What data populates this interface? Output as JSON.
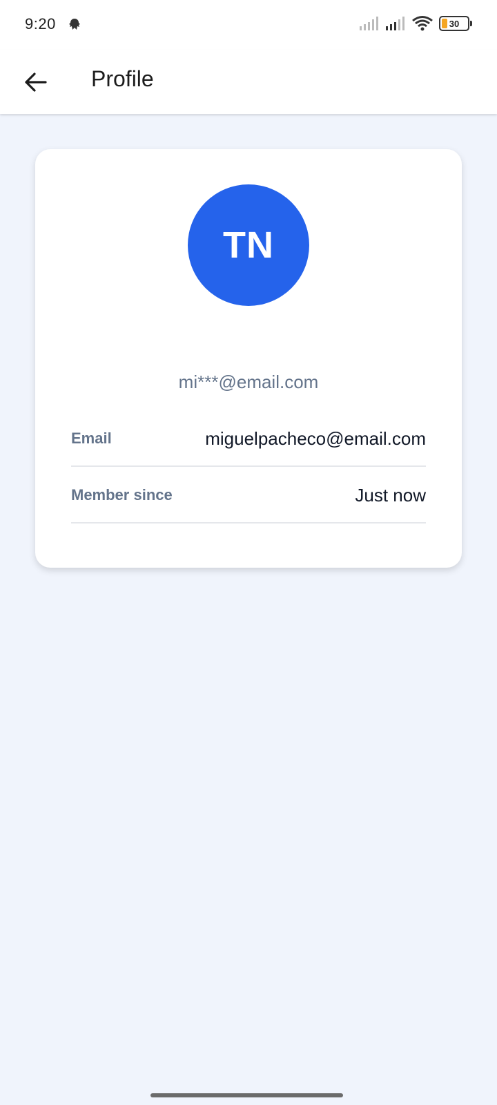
{
  "status_bar": {
    "time": "9:20",
    "battery_level": "30",
    "icons": [
      "notification-icon",
      "signal-icon",
      "signal-icon",
      "wifi-icon",
      "battery-icon"
    ]
  },
  "app_bar": {
    "back_icon": "arrow-left-icon",
    "title": "Profile"
  },
  "profile": {
    "initials": "TN",
    "avatar_color": "#2563eb",
    "masked_email": "mi***@email.com",
    "rows": [
      {
        "label": "Email",
        "value": "miguelpacheco@email.com"
      },
      {
        "label": "Member since",
        "value": "Just now"
      }
    ]
  }
}
